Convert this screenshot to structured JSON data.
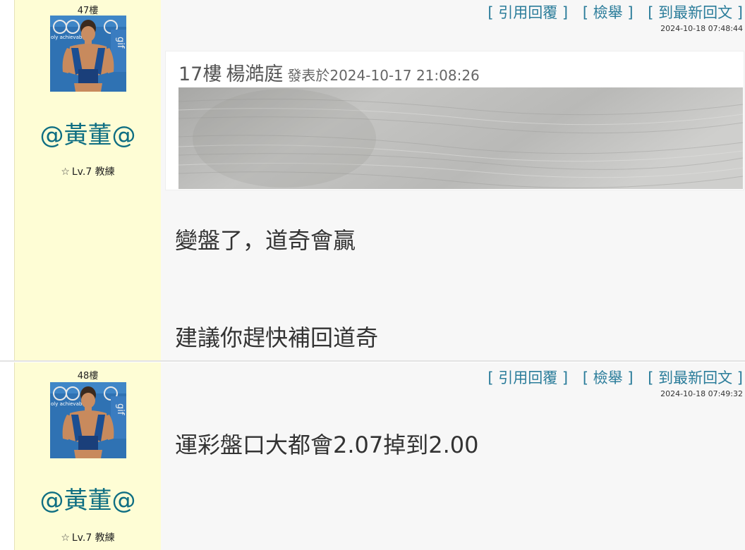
{
  "posts": [
    {
      "floor": "47樓",
      "user": {
        "name": "@黃董@",
        "level": "Lv.7 教練",
        "star_icon": "☆"
      },
      "actions": {
        "quote_reply": "[ 引用回覆 ]",
        "report": "[ 檢舉 ]",
        "latest": "[ 到最新回文 ]"
      },
      "timestamp": "2024-10-18 07:48:44",
      "quote": {
        "floor": "17樓",
        "user": "楊澔庭",
        "meta": "發表於2024-10-17 21:08:26"
      },
      "messages": [
        "變盤了，道奇會贏",
        "建議你趕快補回道奇"
      ]
    },
    {
      "floor": "48樓",
      "user": {
        "name": "@黃董@",
        "level": "Lv.7 教練",
        "star_icon": "☆"
      },
      "actions": {
        "quote_reply": "[ 引用回覆 ]",
        "report": "[ 檢舉 ]",
        "latest": "[ 到最新回文 ]"
      },
      "timestamp": "2024-10-18 07:49:32",
      "messages": [
        "運彩盤口大都會2.07掉到2.00"
      ]
    }
  ],
  "avatar": {
    "sign_text": "oly achievabl",
    "accent": "#2a6fb0"
  },
  "colors": {
    "sidebar_bg": "#fefdd5",
    "main_bg": "#f7f7f7",
    "username": "#0e6e82",
    "action_link": "#2a7c9a"
  }
}
